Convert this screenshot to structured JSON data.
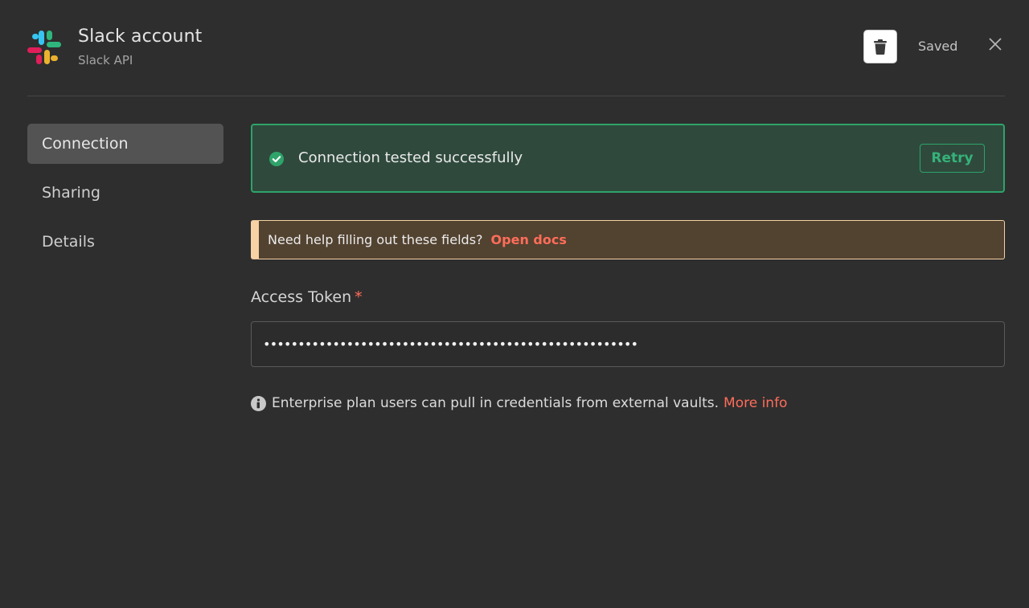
{
  "header": {
    "title": "Slack account",
    "subtitle": "Slack API",
    "status": "Saved",
    "icons": {
      "logo": "slack-logo-icon",
      "delete": "trash-icon",
      "close": "close-icon"
    }
  },
  "sidebar": {
    "items": [
      {
        "label": "Connection",
        "active": true
      },
      {
        "label": "Sharing",
        "active": false
      },
      {
        "label": "Details",
        "active": false
      }
    ]
  },
  "connection": {
    "status_message": "Connection tested successfully",
    "retry_label": "Retry",
    "help_text": "Need help filling out these fields?",
    "help_link": "Open docs",
    "access_token": {
      "label": "Access Token",
      "required_marker": "*",
      "value": "••••••••••••••••••••••••••••••••••••••••••••••••••••••"
    },
    "info_text": "Enterprise plan users can pull in credentials from external vaults.",
    "info_link": "More info"
  },
  "colors": {
    "background": "#2e2e2e",
    "success": "#2ea36a",
    "success_bg": "#2f4a3d",
    "accent_link": "#ff6d5a",
    "warning_border": "#f6d2a5",
    "warning_bg": "#524230"
  }
}
